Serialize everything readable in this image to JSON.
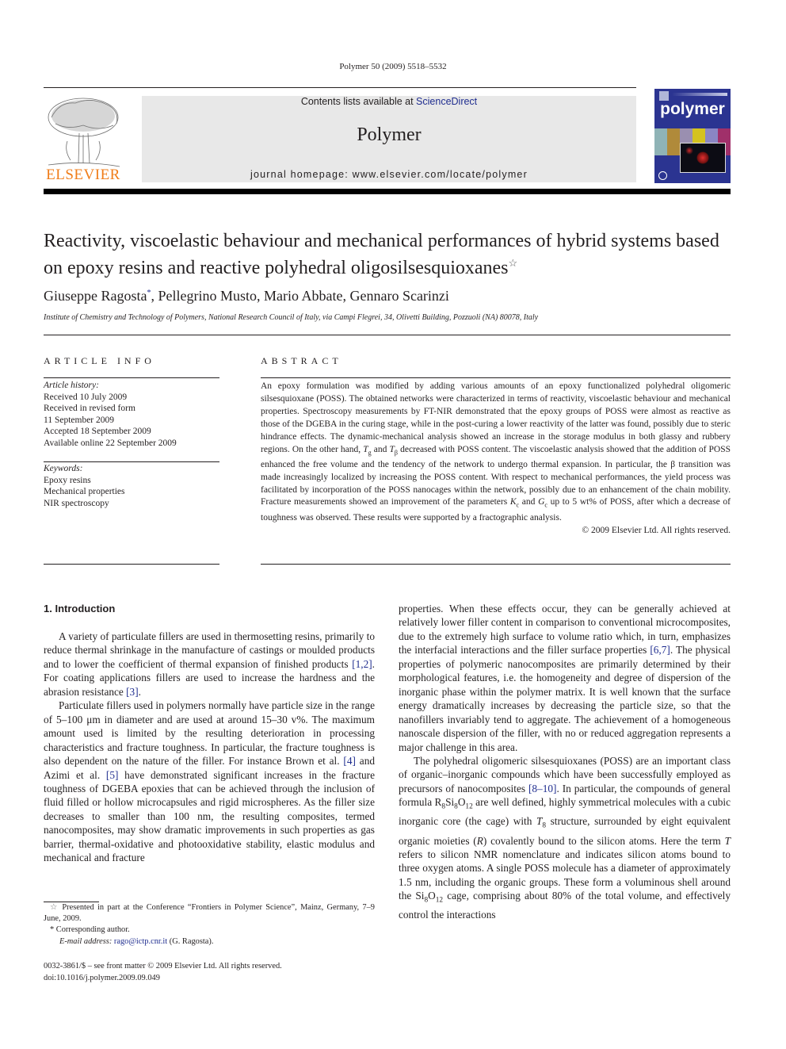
{
  "running_head": "Polymer 50 (2009) 5518–5532",
  "masthead": {
    "contents_prefix": "Contents lists available at ",
    "contents_link": "ScienceDirect",
    "journal_name": "Polymer",
    "homepage": "journal homepage: www.elsevier.com/locate/polymer",
    "publisher_logo_text": "ELSEVIER",
    "cover_title": "polymer",
    "colors": {
      "elsevier_orange": "#f07d1a",
      "cover_blue": "#2b3491",
      "link_blue": "#1f2d8f",
      "masthead_gray": "#e8e8e8"
    }
  },
  "article": {
    "title": "Reactivity, viscoelastic behaviour and mechanical performances of hybrid systems based on epoxy resins and reactive polyhedral oligosilsesquioxanes",
    "title_mark": "☆",
    "authors": [
      {
        "name": "Giuseppe Ragosta",
        "mark": "*"
      },
      {
        "name": "Pellegrino Musto",
        "mark": ""
      },
      {
        "name": "Mario Abbate",
        "mark": ""
      },
      {
        "name": "Gennaro Scarinzi",
        "mark": ""
      }
    ],
    "affiliation": "Institute of Chemistry and Technology of Polymers, National Research Council of Italy, via Campi Flegrei, 34, Olivetti Building, Pozzuoli (NA) 80078, Italy"
  },
  "article_info": {
    "heading": "ARTICLE INFO",
    "history_label": "Article history:",
    "history": [
      "Received 10 July 2009",
      "Received in revised form",
      "11 September 2009",
      "Accepted 18 September 2009",
      "Available online 22 September 2009"
    ],
    "keywords_label": "Keywords:",
    "keywords": [
      "Epoxy resins",
      "Mechanical properties",
      "NIR spectroscopy"
    ]
  },
  "abstract": {
    "heading": "ABSTRACT",
    "parts": {
      "p1": "An epoxy formulation was modified by adding various amounts of an epoxy functionalized polyhedral oligomeric silsesquioxane (POSS). The obtained networks were characterized in terms of reactivity, viscoelastic behaviour and mechanical properties. Spectroscopy measurements by FT-NIR demonstrated that the epoxy groups of POSS were almost as reactive as those of the DGEBA in the curing stage, while in the post-curing a lower reactivity of the latter was found, possibly due to steric hindrance effects. The dynamic-mechanical analysis showed an increase in the storage modulus in both glassy and rubbery regions. On the other hand, ",
      "tg": "T",
      "tg_sub": "g",
      "and": " and ",
      "tb": "T",
      "tb_sub": "β",
      "p2": " decreased with POSS content. The viscoelastic analysis showed that the addition of POSS enhanced the free volume and the tendency of the network to undergo thermal expansion. In particular, the β transition was made increasingly localized by increasing the POSS content. With respect to mechanical performances, the yield process was facilitated by incorporation of the POSS nanocages within the network, possibly due to an enhancement of the chain mobility. Fracture measurements showed an improvement of the parameters ",
      "kc": "K",
      "kc_sub": "c",
      "and2": " and ",
      "gc": "G",
      "gc_sub": "c",
      "p3": " up to 5 wt% of POSS, after which a decrease of toughness was observed. These results were supported by a fractographic analysis."
    },
    "copyright": "© 2009 Elsevier Ltd. All rights reserved."
  },
  "body": {
    "section_heading": "1.  Introduction",
    "left": {
      "p1a": "A variety of particulate fillers are used in thermosetting resins, primarily to reduce thermal shrinkage in the manufacture of cast­ings or moulded products and to lower the coefficient of thermal expansion of finished products ",
      "c1": "[1,2]",
      "p1b": ". For coating applications fillers are used to increase the hardness and the abrasion resistance ",
      "c2": "[3]",
      "p1c": ".",
      "p2a": "Particulate fillers used in polymers normally have particle size in the range of 5–100 μm in diameter and are used at around 15–30 v%. The maximum amount used is limited by the resulting deterioration in processing characteristics and fracture toughness. In particular, the fracture toughness is also dependent on the nature of the filler. For instance Brown et al. ",
      "c3": "[4]",
      "p2b": " and Azimi et al. ",
      "c4": "[5]",
      "p2c": " have demonstrated significant increases in the fracture toughness of DGEBA epoxies that can be achieved through the inclusion of fluid filled or hollow microcapsules and rigid microspheres. As the filler size decreases to smaller than 100 nm, the resulting composites, termed nanocomposites, may show dramatic improvements in such properties as gas barrier, thermal-oxidative and photo­oxidative stability, elastic modulus and mechanical and fracture"
    },
    "right": {
      "p1a": "properties. When these effects occur, they can be generally ach­ieved at relatively lower filler content in comparison to conven­tional microcomposites, due to the extremely high surface to volume ratio which, in turn, emphasizes the interfacial interactions and the filler surface properties ",
      "c1": "[6,7]",
      "p1b": ". The physical properties of polymeric nanocomposites are primarily determined by their morphological features, i.e. the homogeneity and degree of dispersion of the inorganic phase within the polymer matrix. It is well known that the surface energy dramatically increases by decreasing the particle size, so that the nanofillers invariably tend to aggregate. The achievement of a homogeneous nanoscale dispersion of the filler, with no or reduced aggregation represents a major challenge in this area.",
      "p2a": "The polyhedral oligomeric silsesquioxanes (POSS) are an important class of organic–inorganic compounds which have been successfully employed as precursors of nanocomposites ",
      "c2": "[8–10]",
      "p2b": ". In particular, the compounds of general formula R",
      "f1": "8",
      "f2": "Si",
      "f3": "8",
      "f4": "O",
      "f5": "12",
      "p2c": " are well defined, highly symmetrical molecules with a cubic inorganic core (the cage) with ",
      "t8": "T",
      "t8_sub": "8",
      "p2d": " structure, surrounded by eight equivalent organic moieties (",
      "r": "R",
      "p2e": ") covalently bound to the silicon atoms. Here the term ",
      "t": "T",
      "p2f": " refers to silicon NMR nomenclature and indicates silicon atoms bound to three oxygen atoms. A single POSS molecule has a diam­eter of approximately 1.5 nm, including the organic groups. These form a voluminous shell around the Si",
      "g1": "8",
      "g2": "O",
      "g3": "12",
      "p2g": " cage, comprising about 80% of the total volume, and effectively control the interactions"
    }
  },
  "footnotes": {
    "star_mark": "☆",
    "star_text": " Presented in part at the Conference “Frontiers in Polymer Science”, Mainz, Germany, 7–9 June, 2009.",
    "corr_mark": "*",
    "corr_text": " Corresponding author.",
    "email_label": "E-mail address: ",
    "email": "rago@ictp.cnr.it",
    "email_suffix": " (G. Ragosta).",
    "issn": "0032-3861/$ – see front matter © 2009 Elsevier Ltd. All rights reserved.",
    "doi": "doi:10.1016/j.polymer.2009.09.049"
  }
}
